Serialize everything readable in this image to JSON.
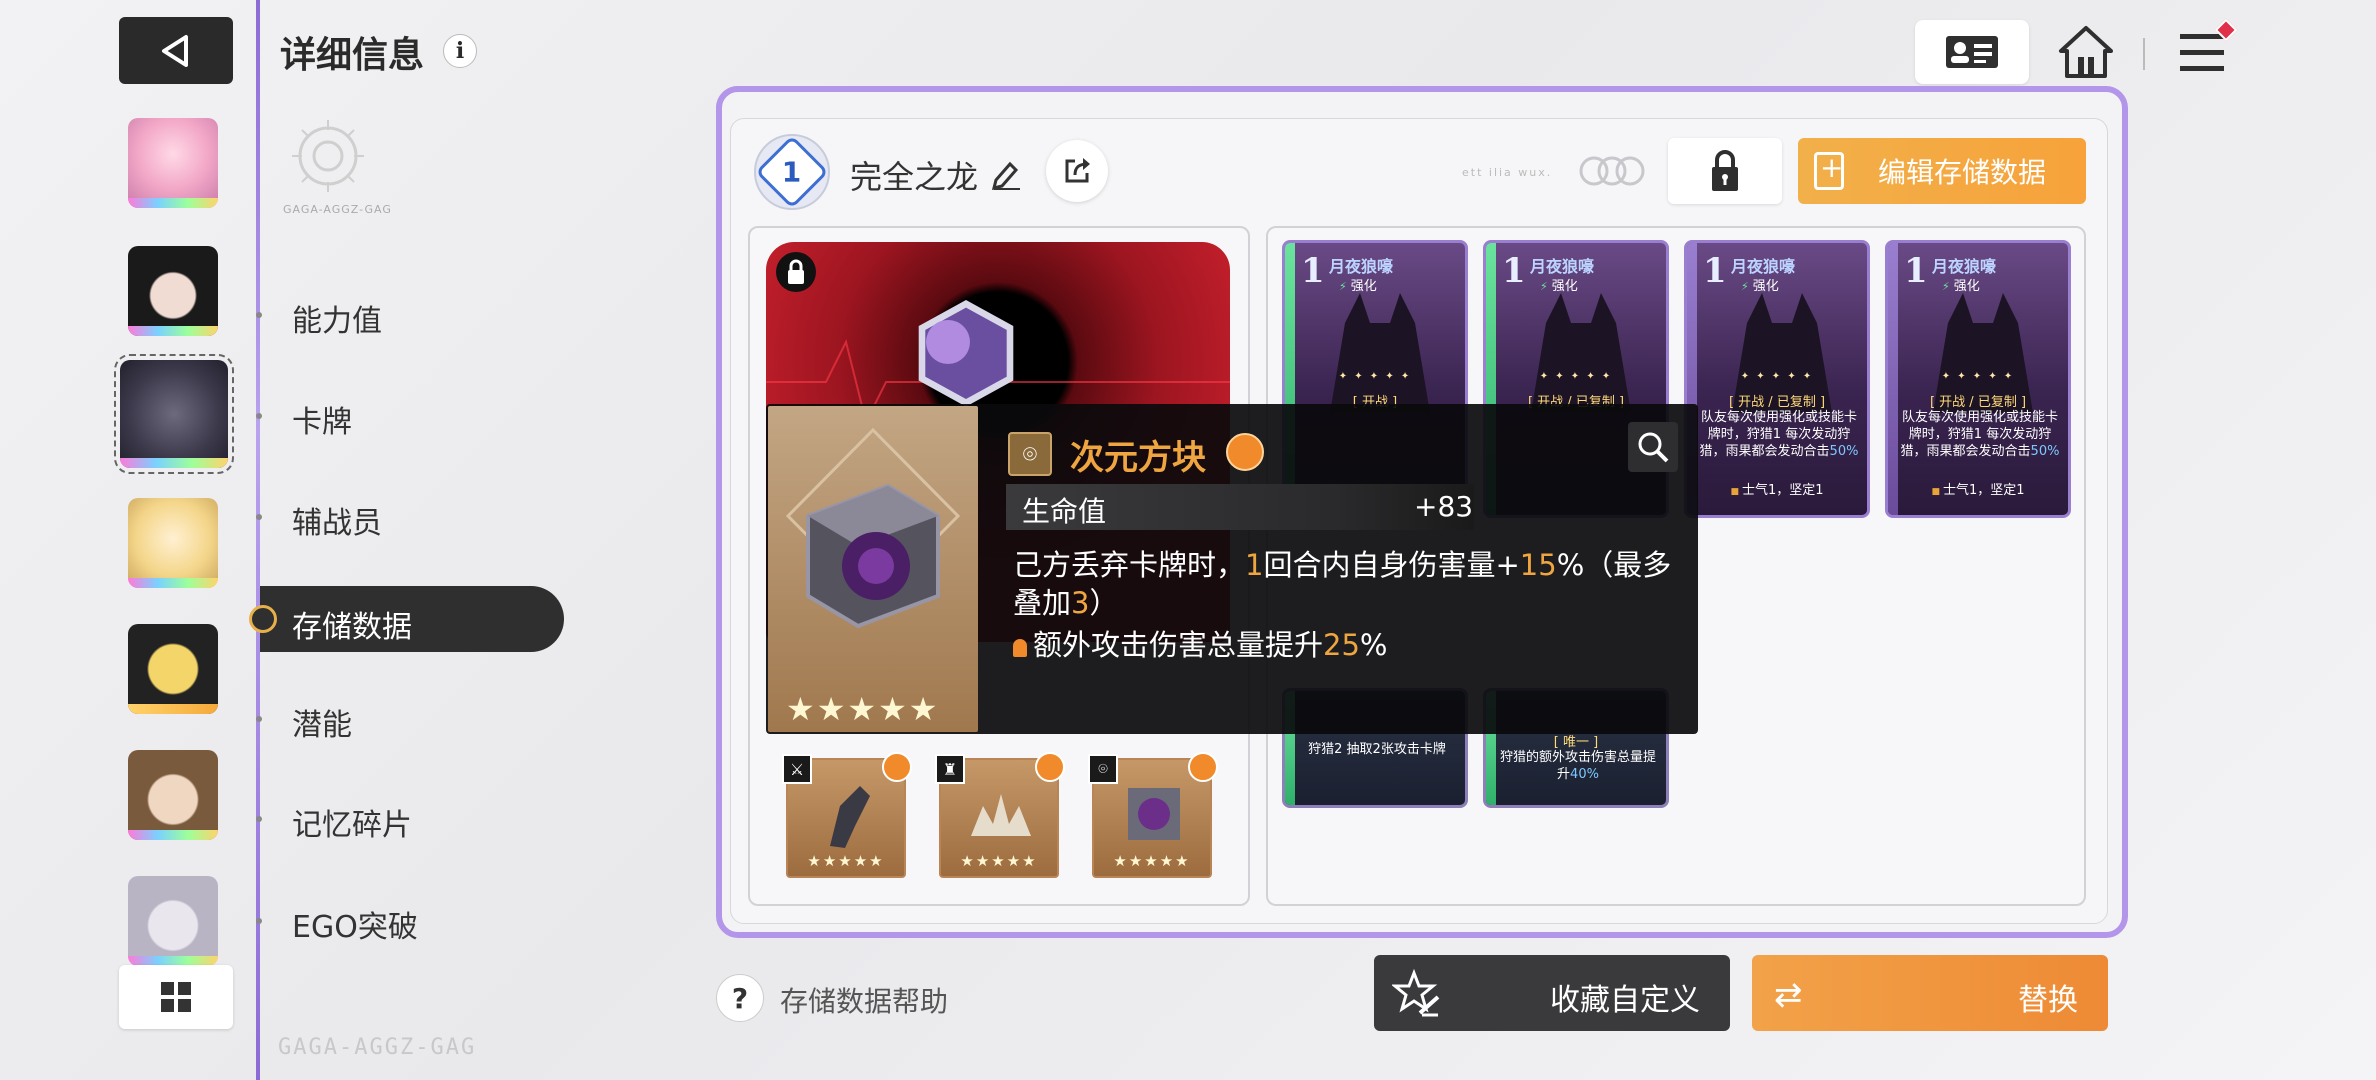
{
  "header": {
    "title": "详细信息",
    "info_glyph": "i",
    "emblem_caption": "GAGA-AGGZ-GAG"
  },
  "nav": {
    "items": [
      "能力值",
      "卡牌",
      "辅战员",
      "存储数据",
      "潜能",
      "记忆碎片",
      "EGO突破"
    ],
    "active": "存储数据"
  },
  "watermark": "GAGA-AGGZ-GAG",
  "deck": {
    "number": "1",
    "name": "完全之龙",
    "edit_label": "编辑存储数据",
    "deco_text": "ett ilia wux."
  },
  "cards": [
    {
      "cost": "1",
      "name": "月夜狼嚎",
      "type": "强化",
      "tag": "[ 开战 ]",
      "desc": "",
      "foot": ""
    },
    {
      "cost": "1",
      "name": "月夜狼嚎",
      "type": "强化",
      "tag": "[ 开战 / 已复制 ]",
      "desc": "",
      "foot": ""
    },
    {
      "cost": "1",
      "name": "月夜狼嚎",
      "type": "强化",
      "tag": "[ 开战 / 已复制 ]",
      "desc": "队友每次使用强化或技能卡牌时，狩猎1 每次发动狩猎，雨果都会发动合击",
      "desc_hl": "50%",
      "foot": "士气1，坚定1"
    },
    {
      "cost": "1",
      "name": "月夜狼嚎",
      "type": "强化",
      "tag": "[ 开战 / 已复制 ]",
      "desc": "队友每次使用强化或技能卡牌时，狩猎1 每次发动狩猎，雨果都会发动合击",
      "desc_hl": "50%",
      "foot": "士气1，坚定1"
    }
  ],
  "cards_lower": [
    {
      "tag": "",
      "desc": "狩猎2 抽取2张攻击卡牌",
      "desc_hl": ""
    },
    {
      "tag": "[ 唯一 ]",
      "desc": "狩猎的额外攻击伤害总量提升",
      "desc_hl": "40%"
    }
  ],
  "equipment": [
    {
      "slot_icon": "sword-icon",
      "glyph": "⚔"
    },
    {
      "slot_icon": "armor-icon",
      "glyph": "♜"
    },
    {
      "slot_icon": "ring-icon",
      "glyph": "⌾"
    }
  ],
  "equip_stars": "★★★★★",
  "tooltip": {
    "name": "次元方块",
    "stat_label": "生命值",
    "stat_value": "+83",
    "desc_a": "己方丢弃卡牌时，",
    "desc_n1": "1",
    "desc_b": "回合内自身伤害量+",
    "desc_n2": "15",
    "desc_c": "%（最多叠加",
    "desc_n3": "3",
    "desc_d": "）",
    "desc2_a": "额外攻击伤害总量提升",
    "desc2_n": "25",
    "desc2_b": "%",
    "stars": "★★★★★"
  },
  "bottom": {
    "help_glyph": "?",
    "help_label": "存储数据帮助",
    "collect_label": "收藏自定义",
    "replace_label": "替换"
  },
  "colors": {
    "accent_purple": "#b395ea",
    "orange": "#f2a249",
    "gold_text": "#f0a640"
  }
}
